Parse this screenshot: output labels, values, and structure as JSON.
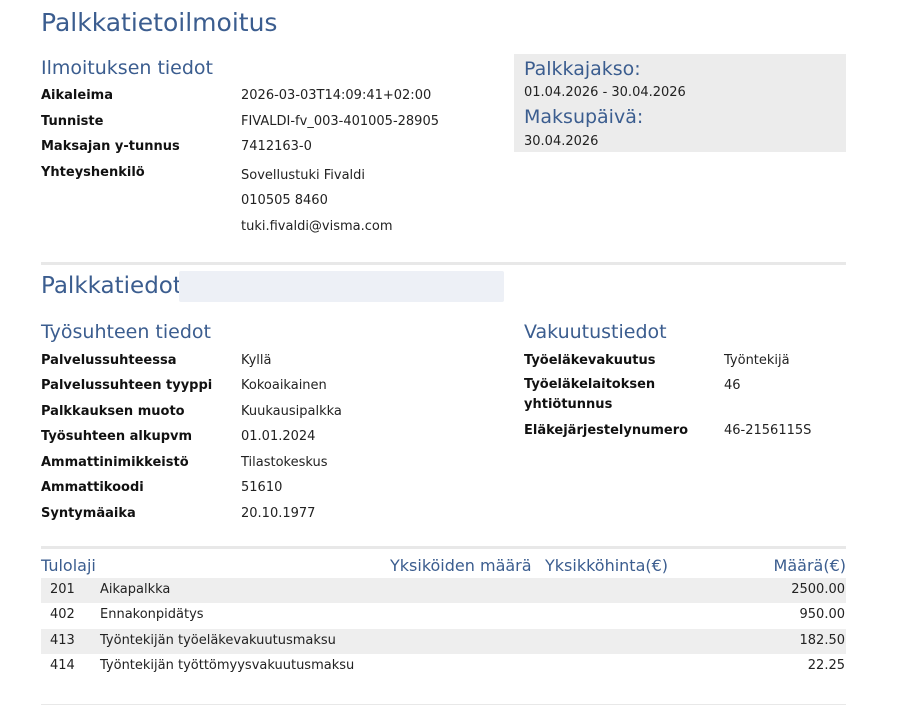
{
  "title": "Palkkatietoilmoitus",
  "notice": {
    "heading": "Ilmoituksen tiedot",
    "fields": [
      {
        "label": "Aikaleima",
        "value": "2026-03-03T14:09:41+02:00"
      },
      {
        "label": "Tunniste",
        "value": "FIVALDI-fv_003-401005-28905"
      },
      {
        "label": "Maksajan y-tunnus",
        "value": "7412163-0"
      }
    ],
    "contact": {
      "label": "Yhteyshenkilö",
      "name": "Sovellustuki Fivaldi",
      "phone": "010505 8460",
      "email": "tuki.fivaldi@visma.com"
    }
  },
  "period": {
    "period_label": "Palkkajakso:",
    "period_value": "01.04.2026 - 30.04.2026",
    "payday_label": "Maksupäivä:",
    "payday_value": "30.04.2026"
  },
  "salary": {
    "heading": "Palkkatiedot,",
    "employment": {
      "heading": "Työsuhteen tiedot",
      "fields": [
        {
          "label": "Palvelussuhteessa",
          "value": "Kyllä"
        },
        {
          "label": "Palvelussuhteen tyyppi",
          "value": "Kokoaikainen"
        },
        {
          "label": "Palkkauksen muoto",
          "value": "Kuukausipalkka"
        },
        {
          "label": "Työsuhteen alkupvm",
          "value": "01.01.2024"
        },
        {
          "label": "Ammattinimikkeistö",
          "value": "Tilastokeskus"
        },
        {
          "label": "Ammattikoodi",
          "value": "51610"
        },
        {
          "label": "Syntymäaika",
          "value": "20.10.1977"
        }
      ]
    },
    "insurance": {
      "heading": "Vakuutustiedot",
      "fields": [
        {
          "label": "Työeläkevakuutus",
          "value": "Työntekijä"
        },
        {
          "label": "Työeläkelaitoksen yhtiötunnus",
          "value": "46"
        },
        {
          "label": "Eläkejärjestelynumero",
          "value": "46-2156115S"
        }
      ]
    }
  },
  "income_table": {
    "headers": {
      "type": "Tulolaji",
      "units": "Yksiköiden määrä",
      "unit_price": "Yksikköhinta(€)",
      "amount": "Määrä(€)"
    },
    "rows": [
      {
        "code": "201",
        "description": "Aikapalkka",
        "amount": "2500.00"
      },
      {
        "code": "402",
        "description": "Ennakonpidätys",
        "amount": "950.00"
      },
      {
        "code": "413",
        "description": "Työntekijän työeläkevakuutusmaksu",
        "amount": "182.50"
      },
      {
        "code": "414",
        "description": "Työntekijän työttömyysvakuutusmaksu",
        "amount": "22.25"
      }
    ]
  }
}
